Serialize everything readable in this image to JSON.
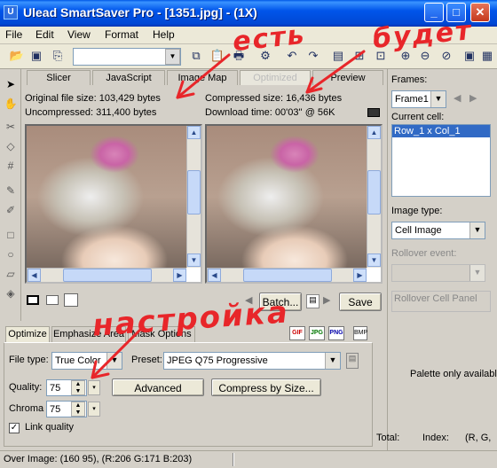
{
  "window": {
    "title": "Ulead SmartSaver Pro - [1351.jpg] - (1X)",
    "controls": {
      "minimize": "_",
      "maximize": "□",
      "close": "✕"
    }
  },
  "menu": [
    "File",
    "Edit",
    "View",
    "Format",
    "Help"
  ],
  "tabs": [
    "Slicer",
    "JavaScript",
    "Image Map",
    "Optimized",
    "Preview"
  ],
  "info": {
    "original_size": "Original file size:  103,429 bytes",
    "uncompressed": "Uncompressed:  311,400 bytes",
    "compressed": "Compressed size: 16,436 bytes",
    "download_time": "Download time:    00'03'' @ 56K"
  },
  "preview_buttons": {
    "batch": "Batch...",
    "save": "Save"
  },
  "right_panel": {
    "frames_label": "Frames:",
    "frame_value": "Frame1",
    "current_cell_label": "Current cell:",
    "cell_item": "Row_1 x Col_1",
    "image_type_label": "Image type:",
    "image_type_value": "Cell Image",
    "rollover_event_label": "Rollover event:",
    "rollover_panel": "Rollover Cell Panel"
  },
  "settings": {
    "tabs": [
      "Optimize",
      "Emphasize Area",
      "Mask Options"
    ],
    "format_icons": [
      "GIF",
      "JPG",
      "PNG",
      "BMP"
    ],
    "file_type_label": "File type:",
    "file_type_value": "True Color",
    "preset_label": "Preset:",
    "preset_value": "JPEG Q75 Progressive",
    "quality_label": "Quality:",
    "quality_value": "75",
    "chroma_label": "Chroma",
    "chroma_value": "75",
    "advanced_button": "Advanced",
    "compress_button": "Compress by Size...",
    "link_quality_label": "Link quality",
    "link_quality_checked": true
  },
  "palette": {
    "note": "Palette only availabl",
    "total_label": "Total:",
    "index_label": "Index:",
    "rgb_label": "(R, G,"
  },
  "status": {
    "text": "Over Image: (160 95), (R:206 G:171 B:203)"
  },
  "annotations": {
    "top_left": "есть",
    "top_right": "будет",
    "middle": "настройка"
  },
  "colors": {
    "annotation_red": "#e8262a",
    "titlebar_blue": "#0055ea",
    "selection_blue": "#316ac5"
  }
}
